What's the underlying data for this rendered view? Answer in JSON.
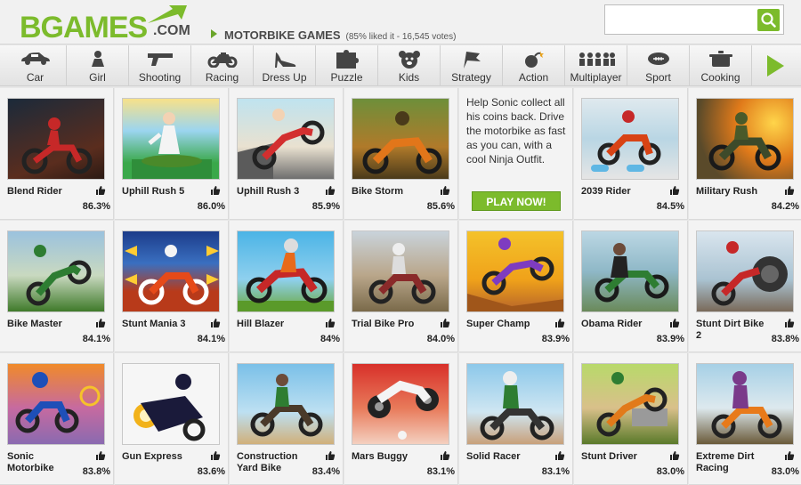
{
  "logo": {
    "main": "BGAMES",
    "tld": ".COM"
  },
  "breadcrumb": {
    "title": "MOTORBIKE GAMES",
    "stats": "(85% liked it - 16,545 votes)"
  },
  "search": {
    "placeholder": "",
    "value": ""
  },
  "nav": [
    {
      "label": "Car",
      "icon": "car-icon"
    },
    {
      "label": "Girl",
      "icon": "girl-icon"
    },
    {
      "label": "Shooting",
      "icon": "gun-icon"
    },
    {
      "label": "Racing",
      "icon": "motorbike-icon"
    },
    {
      "label": "Dress Up",
      "icon": "high-heel-icon"
    },
    {
      "label": "Puzzle",
      "icon": "puzzle-icon"
    },
    {
      "label": "Kids",
      "icon": "teddy-bear-icon"
    },
    {
      "label": "Strategy",
      "icon": "flag-icon"
    },
    {
      "label": "Action",
      "icon": "bomb-icon"
    },
    {
      "label": "Multiplayer",
      "icon": "people-icon"
    },
    {
      "label": "Sport",
      "icon": "football-icon"
    },
    {
      "label": "Cooking",
      "icon": "cooking-pot-icon"
    }
  ],
  "promo": {
    "text": "Help Sonic collect all his coins back. Drive the motorbike as fast as you can, with a cool Ninja Outfit.",
    "button": "PLAY NOW!"
  },
  "games": [
    {
      "title": "Blend Rider",
      "pct": "86.3%"
    },
    {
      "title": "Uphill Rush 5",
      "pct": "86.0%"
    },
    {
      "title": "Uphill Rush 3",
      "pct": "85.9%"
    },
    {
      "title": "Bike Storm",
      "pct": "85.6%"
    },
    {
      "title": "2039 Rider",
      "pct": "84.5%"
    },
    {
      "title": "Military Rush",
      "pct": "84.2%"
    },
    {
      "title": "Bike Master",
      "pct": "84.1%"
    },
    {
      "title": "Stunt Mania 3",
      "pct": "84.1%"
    },
    {
      "title": "Hill Blazer",
      "pct": "84%"
    },
    {
      "title": "Trial Bike Pro",
      "pct": "84.0%"
    },
    {
      "title": "Super Champ",
      "pct": "83.9%"
    },
    {
      "title": "Obama Rider",
      "pct": "83.9%"
    },
    {
      "title": "Stunt Dirt Bike 2",
      "pct": "83.8%"
    },
    {
      "title": "Sonic Motorbike",
      "pct": "83.8%"
    },
    {
      "title": "Gun Express",
      "pct": "83.6%"
    },
    {
      "title": "Construction Yard Bike",
      "pct": "83.4%"
    },
    {
      "title": "Mars Buggy",
      "pct": "83.1%"
    },
    {
      "title": "Solid Racer",
      "pct": "83.1%"
    },
    {
      "title": "Stunt Driver",
      "pct": "83.0%"
    },
    {
      "title": "Extreme Dirt Racing",
      "pct": "83.0%"
    }
  ],
  "colors": {
    "brand_green": "#7cbb2c",
    "text_dark": "#222222"
  }
}
